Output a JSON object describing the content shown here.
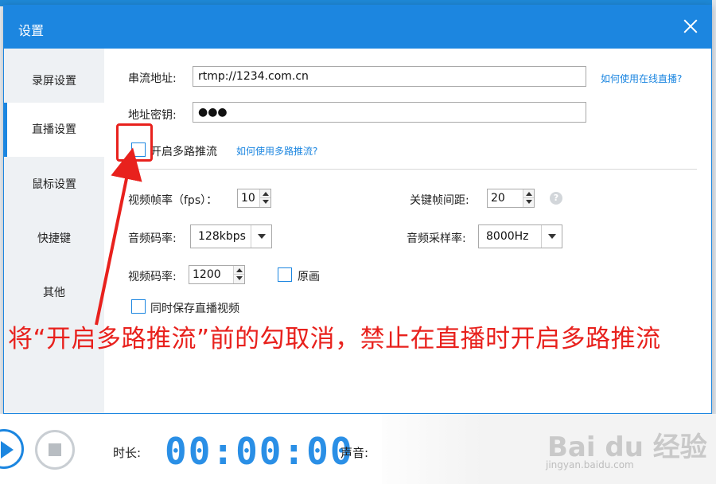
{
  "dialog": {
    "title": "设置"
  },
  "sidebar": {
    "items": [
      {
        "label": "录屏设置"
      },
      {
        "label": "直播设置"
      },
      {
        "label": "鼠标设置"
      },
      {
        "label": "快捷键"
      },
      {
        "label": "其他"
      }
    ],
    "active_index": 1
  },
  "stream": {
    "url_label": "串流地址:",
    "url_value": "rtmp://1234.com.cn",
    "url_help_link": "如何使用在线直播?",
    "key_label": "地址密钥:",
    "key_value": "●●●",
    "multi_push_label": "开启多路推流",
    "multi_push_checked": false,
    "multi_push_help_link": "如何使用多路推流?"
  },
  "settings": {
    "fps_label": "视频帧率（fps）：",
    "fps_value": "10",
    "keyframe_label": "关键帧间距:",
    "keyframe_value": "20",
    "audio_bitrate_label": "音频码率:",
    "audio_bitrate_value": "128kbps",
    "audio_sample_label": "音频采样率:",
    "audio_sample_value": "8000Hz",
    "video_bitrate_label": "视频码率:",
    "video_bitrate_value": "1200",
    "original_label": "原画",
    "original_checked": false,
    "save_video_label": "同时保存直播视频",
    "save_video_checked": false,
    "help_glyph": "?"
  },
  "annotation": {
    "text": "将“开启多路推流”前的勾取消，禁止在直播时开启多路推流",
    "color": "#e8211d"
  },
  "bottom": {
    "duration_label": "时长:",
    "timer": "00:00:00",
    "volume_label": "声音:"
  },
  "watermark": {
    "logo": "Bai du 经验",
    "sub": "jingyan.baidu.com"
  },
  "colors": {
    "accent": "#1c86e0",
    "sidebar_bg": "#eef1f4"
  }
}
